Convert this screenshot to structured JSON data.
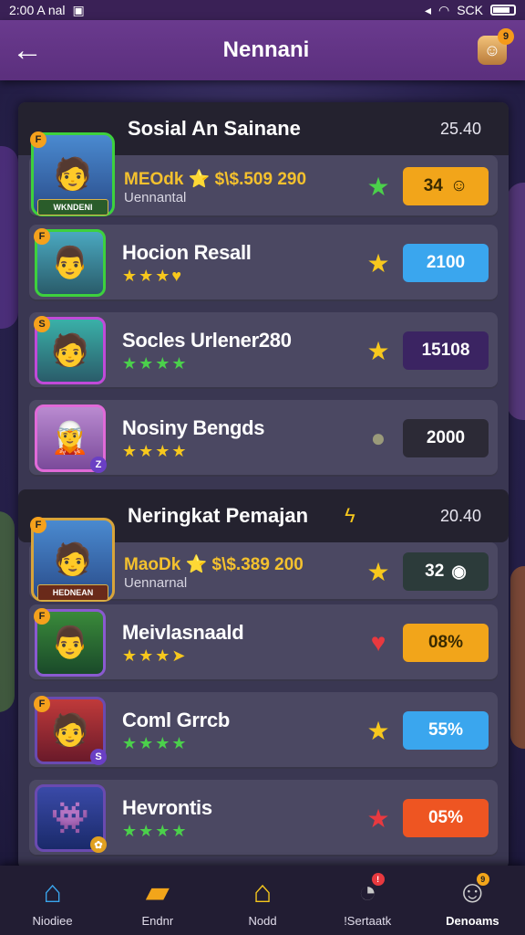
{
  "status_bar": {
    "time": "2:00 A nal",
    "right": "SCK"
  },
  "header": {
    "title": "Nennani",
    "avatar_badge": "9"
  },
  "section1": {
    "title": "Sosial An Sainane",
    "value": "25.40"
  },
  "section2": {
    "title": "Neringkat Pemajan",
    "value": "20.40"
  },
  "rows1": [
    {
      "name": "",
      "sub1": "MEOdk ⭐ $\\$.509 290",
      "sub2": "Uennantal",
      "ribbon": "WKNDENI",
      "icon": "★",
      "icon_color": "#4bd04b",
      "pill": "34",
      "pill_color": "#f2a51a",
      "pill_text_color": "#3a2a00"
    },
    {
      "name": "Hocion Resall",
      "stars": "★★★♥",
      "icon": "★",
      "icon_color": "#f7c81d",
      "pill": "2100",
      "pill_color": "#3aa6ee",
      "pill_text_color": "#ffffff"
    },
    {
      "name": "Socles Urlener280",
      "stars": "★★★★",
      "icon": "★",
      "icon_color": "#f7c81d",
      "pill": "15108",
      "pill_color": "#3b2462",
      "pill_text_color": "#ffffff"
    },
    {
      "name": "Nosiny Bengds",
      "stars": "★★★★",
      "icon": "●",
      "icon_color": "#9a9a7a",
      "pill": "2000",
      "pill_color": "#2c2a36",
      "pill_text_color": "#ffffff"
    }
  ],
  "rows2": [
    {
      "sub1": "MaoDk ⭐ $\\$.389 200",
      "sub2": "Uennarnal",
      "ribbon": "HEDNEAN",
      "icon": "★",
      "icon_color": "#f7c81d",
      "pill": "32",
      "pill_color": "#2c3b3a",
      "pill_text_color": "#ffffff"
    },
    {
      "name": "Meivlasnaald",
      "stars": "★★★➤",
      "icon": "♥",
      "icon_color": "#e8393f",
      "pill": "08%",
      "pill_color": "#f2a51a",
      "pill_text_color": "#3a2a00"
    },
    {
      "name": "Coml Grrcb",
      "stars": "★★★★",
      "icon": "★",
      "icon_color": "#f7c81d",
      "pill": "55%",
      "pill_color": "#3aa6ee",
      "pill_text_color": "#ffffff"
    },
    {
      "name": "Hevrontis",
      "stars": "★★★★",
      "icon": "★",
      "icon_color": "#e8393f",
      "pill": "05%",
      "pill_color": "#ee5522",
      "pill_text_color": "#ffffff"
    }
  ],
  "nav": [
    {
      "label": "Niodiee",
      "icon": "⌂"
    },
    {
      "label": "Endnr",
      "icon": "▰"
    },
    {
      "label": "Nodd",
      "icon": "⌂"
    },
    {
      "label": "!Sertaatk",
      "icon": "◔"
    },
    {
      "label": "Denoams",
      "icon": "☺"
    }
  ],
  "colors": {
    "header": "#5b2f7d",
    "panel": "#3a3752",
    "row": "#4b4862"
  }
}
